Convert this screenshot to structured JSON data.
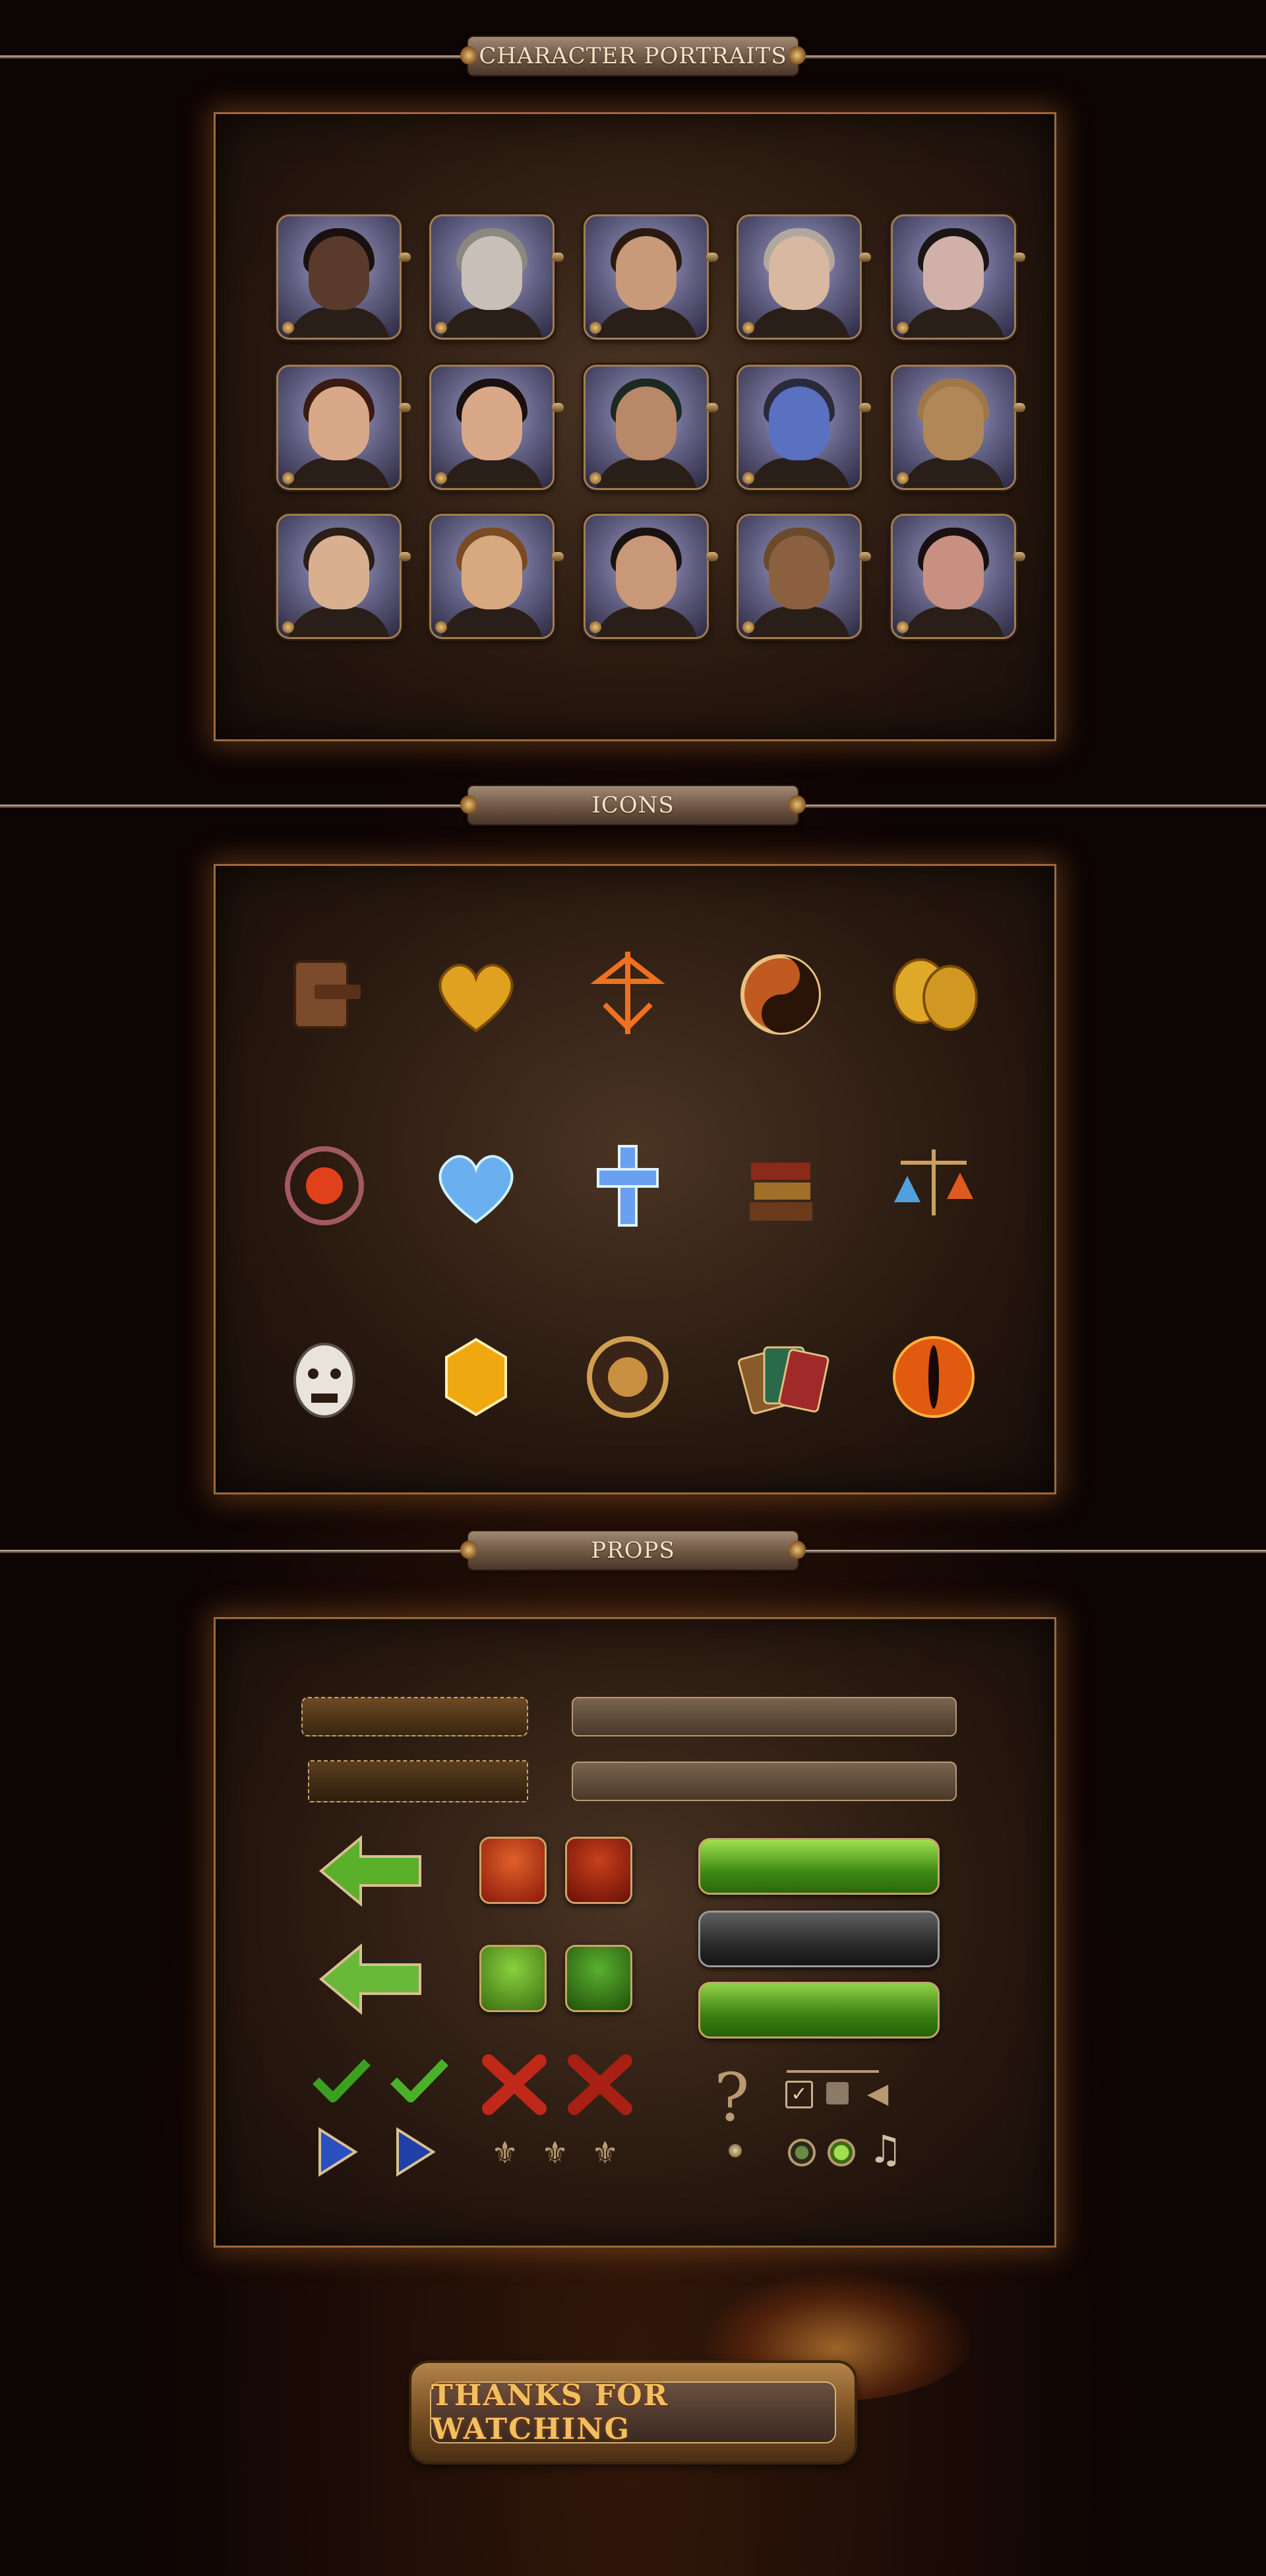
{
  "sections": {
    "portraits_title": "CHARACTER PORTRAITS",
    "icons_title": "ICONS",
    "props_title": "PROPS"
  },
  "portraits": [
    {
      "name": "bald-man"
    },
    {
      "name": "grinning-man-sketch"
    },
    {
      "name": "young-man"
    },
    {
      "name": "old-woman"
    },
    {
      "name": "crying-woman"
    },
    {
      "name": "dark-haired-woman"
    },
    {
      "name": "smiling-woman"
    },
    {
      "name": "police-officer"
    },
    {
      "name": "blue-demon"
    },
    {
      "name": "wooden-mannequin"
    },
    {
      "name": "long-haired-man"
    },
    {
      "name": "red-haired-woman"
    },
    {
      "name": "mustached-man"
    },
    {
      "name": "robot-mask"
    },
    {
      "name": "wild-haired-woman"
    }
  ],
  "icons": [
    "journal-icon",
    "gold-heart-icon",
    "flame-sigil-icon",
    "yin-yang-icon",
    "theater-masks-icon",
    "orb-ring-icon",
    "crystal-heart-icon",
    "crystal-cross-icon",
    "book-stack-icon",
    "scales-icon",
    "demon-mask-icon",
    "amber-gem-icon",
    "medallion-icon",
    "cards-icon",
    "eye-icon"
  ],
  "footer": {
    "thanks_label": "THANKS FOR WATCHING"
  }
}
